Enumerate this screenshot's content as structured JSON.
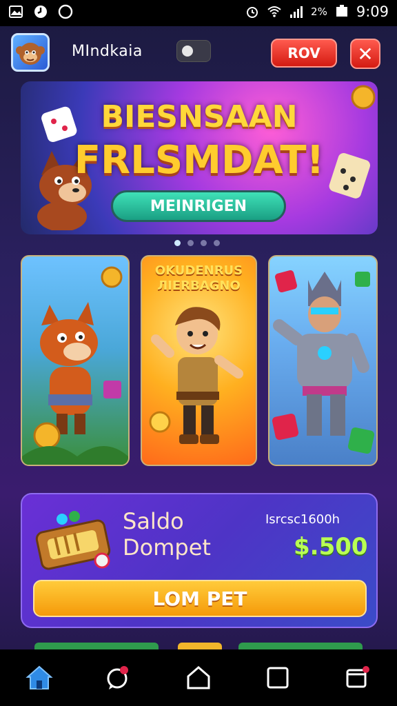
{
  "status_bar": {
    "time": "9:09",
    "battery_text": "2%",
    "icons": [
      "image-icon",
      "data-saver-icon",
      "circle-icon",
      "alarm-icon",
      "wifi-icon",
      "signal-icon",
      "battery-icon"
    ]
  },
  "header": {
    "username": "MIndkaia",
    "red_button_label": "ROV",
    "close_icon": "close-icon"
  },
  "banner": {
    "title_line1": "BIESNSAAN",
    "title_line2": "FRLSMDAT!",
    "button_label": "MEINRIGEN",
    "dots_total": 4,
    "dots_active_index": 0
  },
  "game_cards": [
    {
      "title": ""
    },
    {
      "title": "OKUDENRUS ЛIERBAGNO"
    },
    {
      "title": ""
    }
  ],
  "wallet": {
    "title": "Saldo\nDompet",
    "subtitle": "Isrcsc1600h",
    "amount": "$.500",
    "button_label": "LOM PET"
  },
  "bottom_nav": {
    "items": [
      "home-icon",
      "chat-icon",
      "home-outline-icon",
      "square-icon",
      "recents-icon"
    ],
    "active_index": 0
  },
  "colors": {
    "accent_red": "#e0261c",
    "accent_green": "#22b493",
    "wallet_amount": "#b9ff54",
    "wallet_button": "#f8a61a",
    "nav_active": "#2f8be6"
  }
}
